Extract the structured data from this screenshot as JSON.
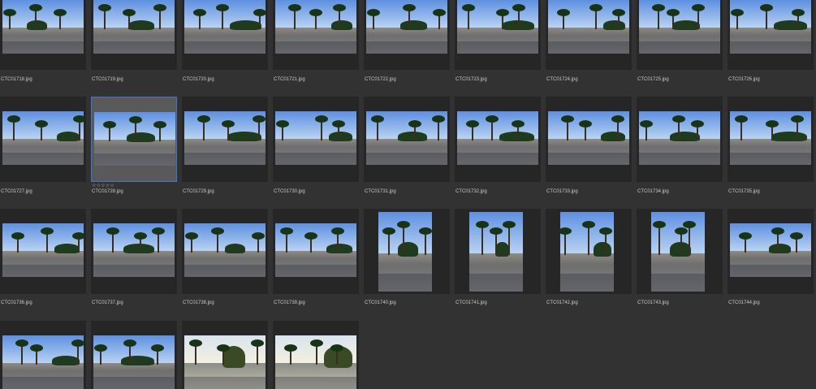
{
  "window": {
    "background": "#323232"
  },
  "rating_stars": "☆☆☆☆☆",
  "thumbnails": [
    {
      "file": "CTC01718.jpg"
    },
    {
      "file": "CTC01719.jpg"
    },
    {
      "file": "CTC01720.jpg"
    },
    {
      "file": "CTC01721.jpg"
    },
    {
      "file": "CTC01722.jpg"
    },
    {
      "file": "CTC01723.jpg"
    },
    {
      "file": "CTC01724.jpg"
    },
    {
      "file": "CTC01725.jpg"
    },
    {
      "file": "CTC01726.jpg"
    },
    {
      "file": "CTC01727.jpg"
    },
    {
      "file": "CTC01728.jpg",
      "selected": true
    },
    {
      "file": "CTC01729.jpg"
    },
    {
      "file": "CTC01730.jpg"
    },
    {
      "file": "CTC01731.jpg"
    },
    {
      "file": "CTC01732.jpg"
    },
    {
      "file": "CTC01733.jpg"
    },
    {
      "file": "CTC01734.jpg"
    },
    {
      "file": "CTC01735.jpg"
    },
    {
      "file": "CTC01736.jpg"
    },
    {
      "file": "CTC01737.jpg"
    },
    {
      "file": "CTC01738.jpg"
    },
    {
      "file": "CTC01739.jpg"
    },
    {
      "file": "CTC01740.jpg",
      "orientation": "portrait"
    },
    {
      "file": "CTC01741.jpg",
      "orientation": "portrait"
    },
    {
      "file": "CTC01742.jpg",
      "orientation": "portrait"
    },
    {
      "file": "CTC01743.jpg",
      "orientation": "portrait"
    },
    {
      "file": "CTC01744.jpg"
    },
    {
      "file": ""
    },
    {
      "file": ""
    },
    {
      "file": "",
      "style": "golden"
    },
    {
      "file": "",
      "style": "golden"
    }
  ]
}
